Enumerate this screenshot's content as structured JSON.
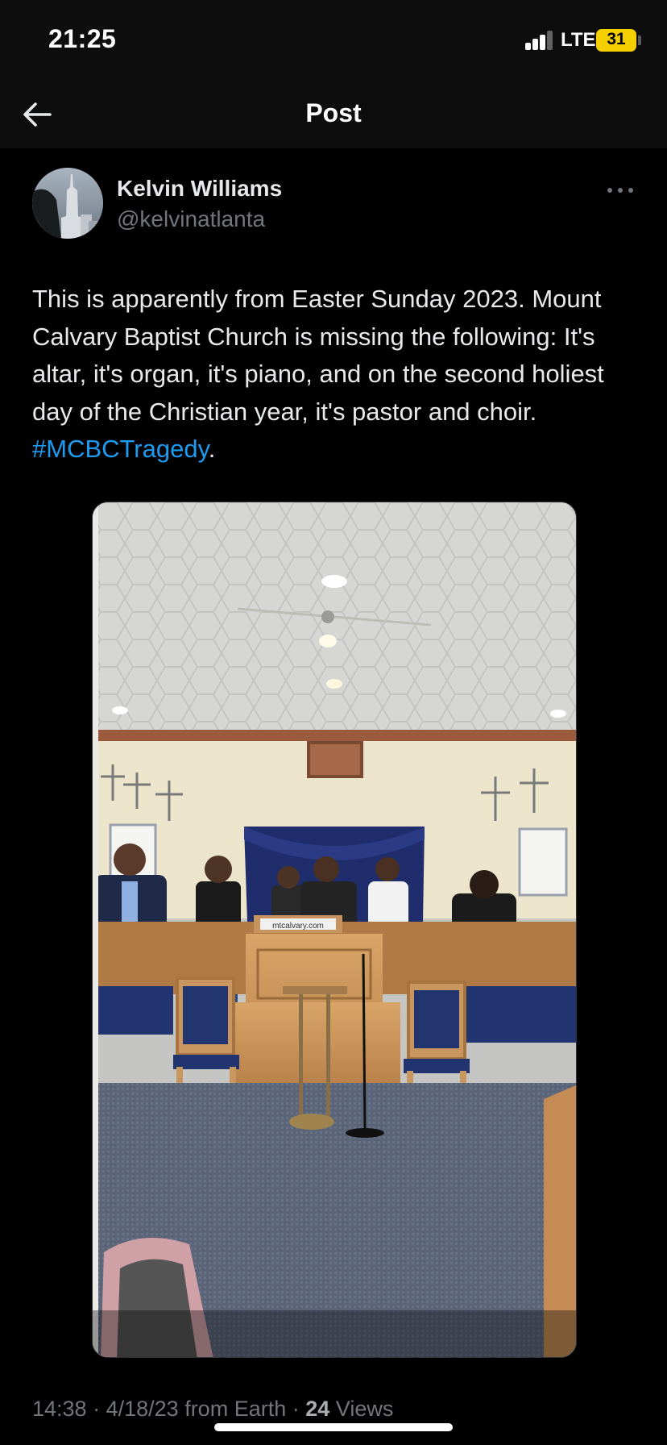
{
  "status_bar": {
    "time": "21:25",
    "network": "LTE",
    "battery": "31"
  },
  "header": {
    "title": "Post",
    "back_icon": "arrow-left-icon"
  },
  "post": {
    "author_name": "Kelvin Williams",
    "author_handle": "@kelvinatlanta",
    "text_before_hashtag": "This is apparently from Easter Sunday 2023. Mount Calvary Baptist Church is missing the following: It's altar, it's organ, it's piano, and on the second holiest day of the Christian year, it's pastor and choir. ",
    "hashtag": "#MCBCTragedy",
    "text_after_hashtag": ".",
    "media": {
      "sign_text": "mtcalvary.com"
    },
    "meta": {
      "time": "14:38",
      "date": "4/18/23",
      "source": "from Earth",
      "views_count": "24",
      "views_label": "Views"
    }
  },
  "colors": {
    "background": "#000000",
    "accent": "#1d9bf0",
    "secondary_text": "#71767b",
    "battery": "#f5d000"
  }
}
